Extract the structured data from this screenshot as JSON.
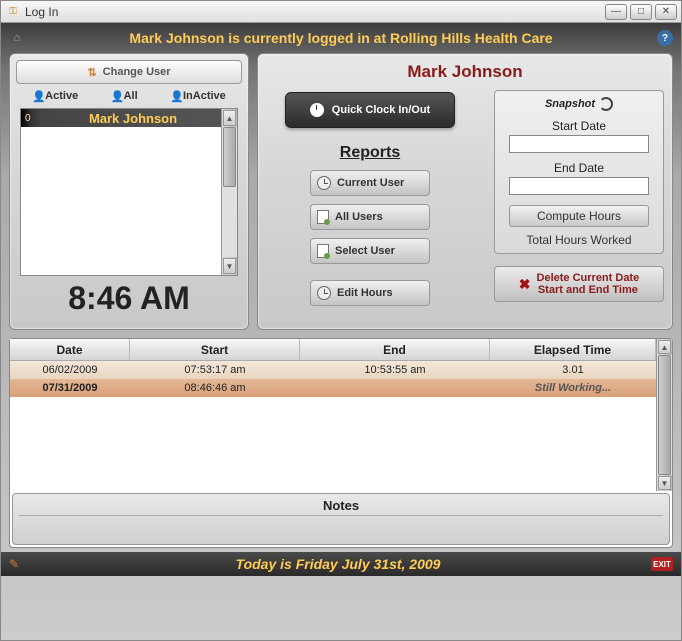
{
  "window": {
    "title": "Log In"
  },
  "banner": {
    "text": "Mark Johnson  is currently logged in at Rolling Hills Health Care"
  },
  "left": {
    "change_user": "Change User",
    "filters": {
      "active": "Active",
      "all": "All",
      "inactive": "InActive"
    },
    "list": {
      "index": "0",
      "selected_name": "Mark Johnson"
    },
    "clock": "8:46 AM"
  },
  "right": {
    "header": "Mark Johnson",
    "quick": "Quick Clock In/Out",
    "reports_title": "Reports",
    "buttons": {
      "current_user": "Current User",
      "all_users": "All Users",
      "select_user": "Select User",
      "edit_hours": "Edit Hours"
    },
    "snapshot": {
      "title": "Snapshot",
      "start_label": "Start Date",
      "end_label": "End Date",
      "compute": "Compute Hours",
      "total": "Total Hours Worked"
    },
    "delete": {
      "line1": "Delete Current Date",
      "line2": "Start and End Time"
    }
  },
  "table": {
    "headers": {
      "date": "Date",
      "start": "Start",
      "end": "End",
      "elapsed": "Elapsed Time"
    },
    "rows": [
      {
        "date": "06/02/2009",
        "start": "07:53:17 am",
        "end": "10:53:55 am",
        "elapsed": "3.01"
      },
      {
        "date": "07/31/2009",
        "start": "08:46:46 am",
        "end": "",
        "elapsed": "Still Working..."
      }
    ]
  },
  "notes": {
    "title": "Notes"
  },
  "footer": {
    "text": "Today is Friday July 31st, 2009",
    "exit": "EXIT"
  }
}
